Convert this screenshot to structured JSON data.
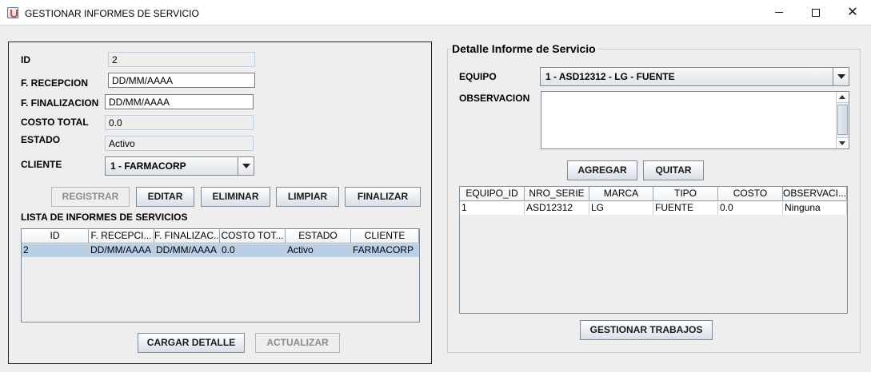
{
  "window": {
    "title": "GESTIONAR INFORMES DE SERVICIO"
  },
  "form": {
    "id_label": "ID",
    "id_value": "2",
    "reception_label": "F. RECEPCION",
    "reception_value": "DD/MM/AAAA",
    "finalization_label": "F. FINALIZACION",
    "finalization_value": "DD/MM/AAAA",
    "total_cost_label": "COSTO TOTAL",
    "total_cost_value": "0.0",
    "status_label": "ESTADO",
    "status_value": "Activo",
    "client_label": "CLIENTE",
    "client_value": "1 - FARMACORP"
  },
  "actions": {
    "register": "REGISTRAR",
    "edit": "EDITAR",
    "delete": "ELIMINAR",
    "clear": "LIMPIAR",
    "finalize": "FINALIZAR",
    "load_detail": "CARGAR DETALLE",
    "update": "ACTUALIZAR"
  },
  "reports_list": {
    "title": "LISTA DE INFORMES DE SERVICIOS",
    "columns": [
      "ID",
      "F. RECEPCI...",
      "F. FINALIZAC...",
      "COSTO TOT...",
      "ESTADO",
      "CLIENTE"
    ],
    "rows": [
      [
        "2",
        "DD/MM/AAAA",
        "DD/MM/AAAA",
        "0.0",
        "Activo",
        "FARMACORP"
      ]
    ]
  },
  "detail": {
    "title": "Detalle Informe de Servicio",
    "equipment_label": "EQUIPO",
    "equipment_value": "1 - ASD12312 - LG - FUENTE",
    "observation_label": "OBSERVACION",
    "observation_value": "",
    "add": "AGREGAR",
    "remove": "QUITAR",
    "manage_jobs": "GESTIONAR TRABAJOS",
    "columns": [
      "EQUIPO_ID",
      "NRO_SERIE",
      "MARCA",
      "TIPO",
      "COSTO",
      "OBSERVACI..."
    ],
    "rows": [
      [
        "1",
        "ASD12312",
        "LG",
        "FUENTE",
        "0.0",
        "Ninguna"
      ]
    ]
  }
}
